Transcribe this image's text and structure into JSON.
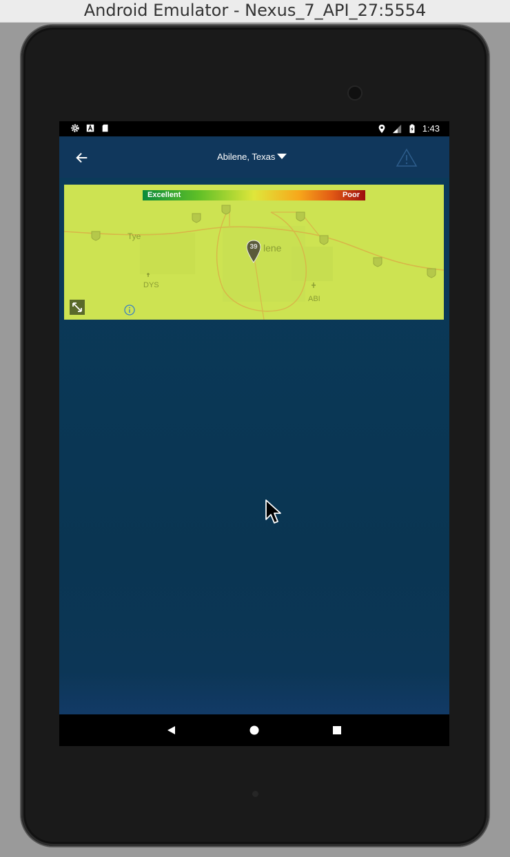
{
  "window": {
    "title": "Android Emulator - Nexus_7_API_27:5554"
  },
  "status_bar": {
    "left_icons": [
      "gear-icon",
      "a-badge-icon",
      "sd-card-icon"
    ],
    "right_icons": [
      "location-pin-icon",
      "signal-icon",
      "battery-icon"
    ],
    "time": "1:43"
  },
  "app_bar": {
    "back_icon": "arrow-left-icon",
    "location": "Abilene, Texas",
    "alert_icon": "warning-triangle-icon"
  },
  "map": {
    "legend": {
      "good_label": "Excellent",
      "bad_label": "Poor"
    },
    "aqi_marker": {
      "value": "39"
    },
    "labels": {
      "city": "lene",
      "town": "Tye",
      "airport_west": "DYS",
      "airport_east": "ABI"
    },
    "highway_shields": [
      "20",
      "83",
      "20",
      "20",
      "20",
      "20",
      "20"
    ],
    "colors": {
      "overlay": "#cfe453",
      "pin": "#5a5a3a"
    }
  },
  "nav_bar": {
    "icons": [
      "back-triangle-icon",
      "home-circle-icon",
      "recents-square-icon"
    ]
  }
}
